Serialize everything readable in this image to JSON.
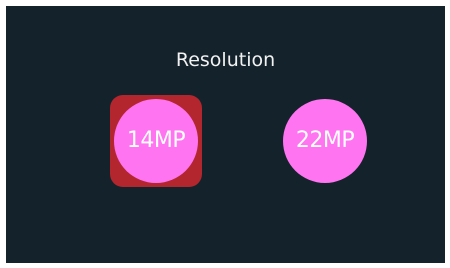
{
  "screen": {
    "title": "Resolution"
  },
  "options": [
    {
      "label": "14MP",
      "selected": true
    },
    {
      "label": "22MP",
      "selected": false
    }
  ],
  "colors": {
    "background": "#14232b",
    "selection_highlight": "#b3262d",
    "option_circle": "#ff74f0",
    "text": "#ffffff"
  }
}
